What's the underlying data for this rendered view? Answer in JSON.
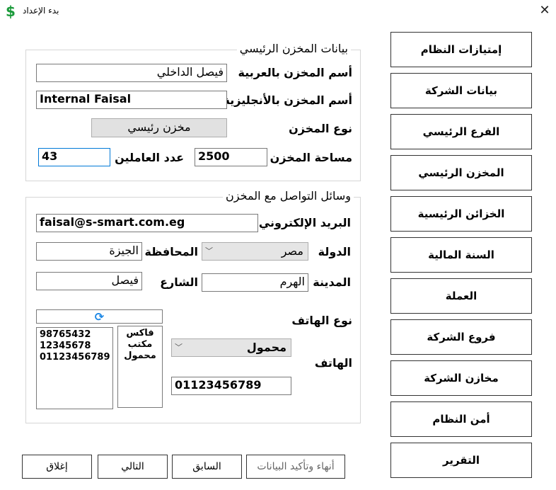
{
  "window": {
    "title": "بدء الإعداد",
    "app_icon": "dollar-icon",
    "close_glyph": "✕"
  },
  "warehouse_group": {
    "legend": "بيانات المخزن الرئيسي",
    "arabic_name_label": "أسم المخزن بالعربية",
    "arabic_name_value": "فيصل الداخلي",
    "english_name_label": "أسم المخزن بالأنجليزية",
    "english_name_value": "Internal Faisal",
    "type_label": "نوع المخزن",
    "type_value": "مخزن رئيسي",
    "area_label": "مساحة المخزن",
    "area_value": "2500",
    "workers_label": "عدد العاملين",
    "workers_value": "43"
  },
  "contact_group": {
    "legend": "وسائل التواصل مع المخزن",
    "email_label": "البريد الإلكتروني",
    "email_value": "faisal@s-smart.com.eg",
    "country_label": "الدولة",
    "country_value": "مصر",
    "governorate_label": "المحافظة",
    "governorate_value": "الجيزة",
    "city_label": "المدينة",
    "city_value": "الهرم",
    "street_label": "الشارع",
    "street_value": "فيصل",
    "phone_type_label": "نوع الهاتف",
    "phone_type_value": "محمول",
    "phone_label": "الهاتف",
    "phone_value": "01123456789",
    "phone_numbers": [
      "98765432",
      "12345678",
      "01123456789"
    ],
    "phone_types": [
      "فاكس",
      "مكتب",
      "محمول"
    ]
  },
  "sidebar": [
    "إمتيازات النظام",
    "بيانات الشركة",
    "الفرع الرئيسي",
    "المخزن الرئيسي",
    "الخزائن الرئيسية",
    "السنة المالية",
    "العملة",
    "فروع الشركة",
    "مخازن الشركة",
    "أمن النظام",
    "التقرير"
  ],
  "bottom": {
    "finish": "أنهاء وتأكيد البيانات",
    "previous": "السابق",
    "next": "التالي",
    "close": "إغلاق"
  },
  "colors": {
    "accent": "#0078d7",
    "icon_green": "#1a9a3a",
    "refresh_blue": "#1e88e5"
  }
}
